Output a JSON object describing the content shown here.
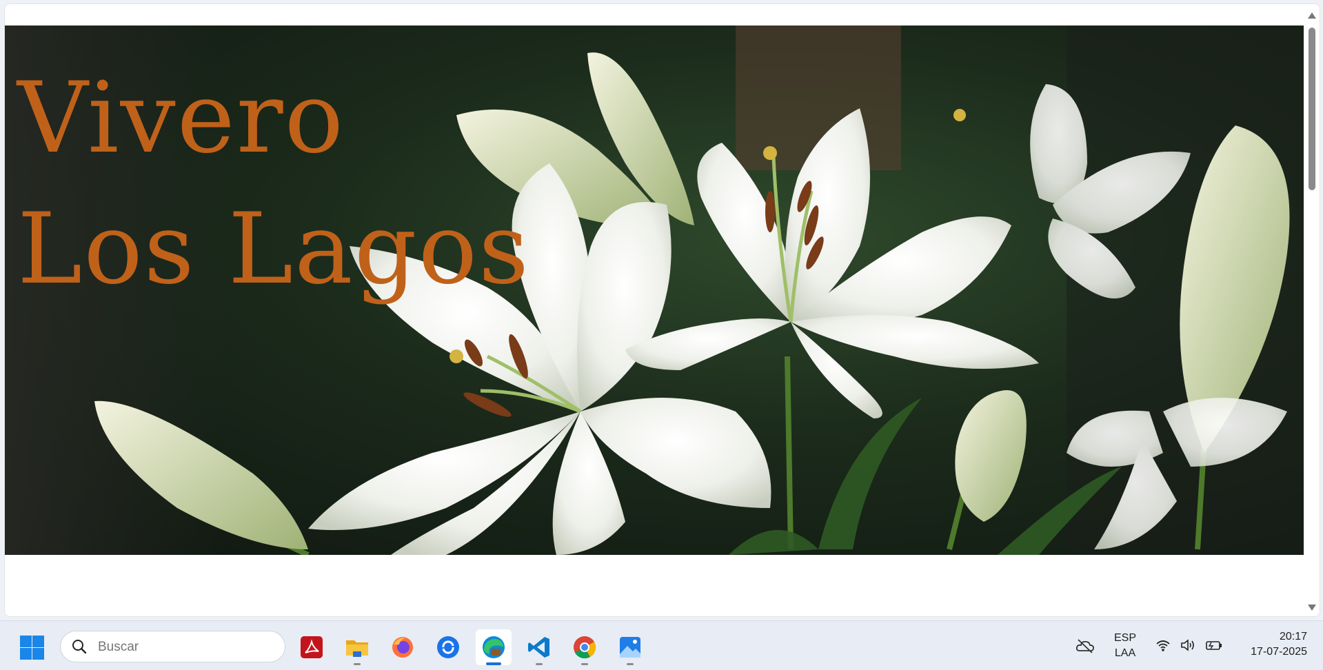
{
  "hero": {
    "title_line1": "Vivero",
    "title_line2": "Los Lagos",
    "title_color": "#c0611a"
  },
  "taskbar": {
    "search_placeholder": "Buscar",
    "apps": [
      {
        "name": "acrobat-reader",
        "icon": "pdf-icon",
        "open": false
      },
      {
        "name": "file-explorer",
        "icon": "folder-icon",
        "open": true
      },
      {
        "name": "firefox",
        "icon": "firefox-icon",
        "open": false
      },
      {
        "name": "app-sync",
        "icon": "sync-app-icon",
        "open": false
      },
      {
        "name": "edge",
        "icon": "edge-icon",
        "open": true,
        "active": true
      },
      {
        "name": "vscode",
        "icon": "vscode-icon",
        "open": true
      },
      {
        "name": "chrome",
        "icon": "chrome-icon",
        "open": true
      },
      {
        "name": "photos",
        "icon": "photos-icon",
        "open": true
      }
    ],
    "tray": {
      "language_line1": "ESP",
      "language_line2": "LAA",
      "time": "20:17",
      "date": "17-07-2025"
    }
  },
  "colors": {
    "accent": "#1b6fd6",
    "windows_blue": "#1a86e8"
  }
}
